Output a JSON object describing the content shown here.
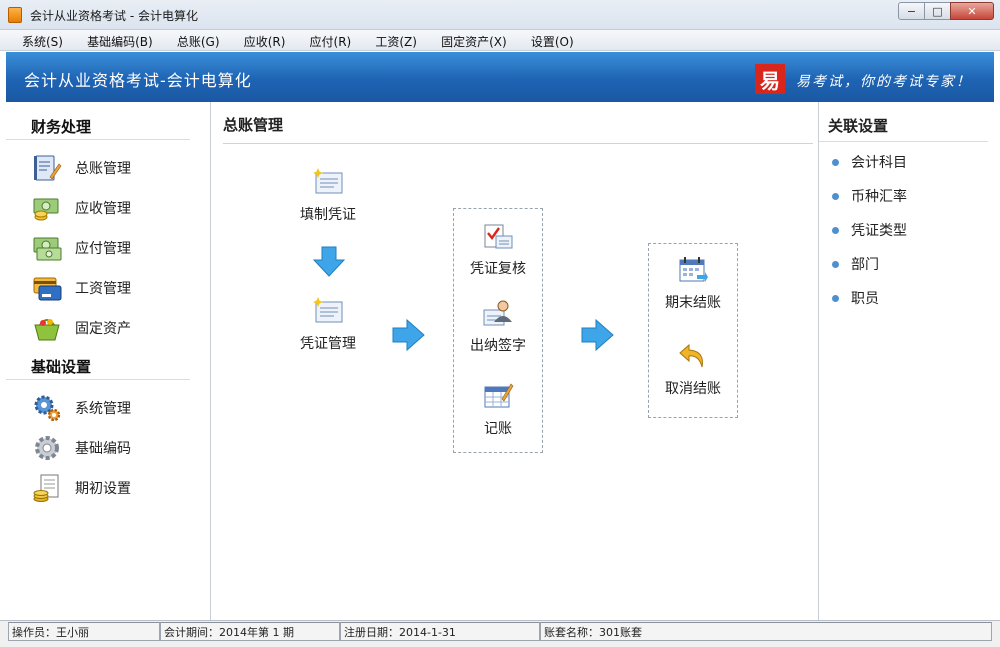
{
  "window": {
    "title": "会计从业资格考试 - 会计电算化",
    "minimize": "−",
    "maximize": "□",
    "close": "✕"
  },
  "menu": [
    "系统(S)",
    "基础编码(B)",
    "总账(G)",
    "应收(R)",
    "应付(R)",
    "工资(Z)",
    "固定资产(X)",
    "设置(O)"
  ],
  "banner": {
    "title": "会计从业资格考试-会计电算化",
    "logo_char": "易",
    "slogan": "易考试，你的考试专家！"
  },
  "left": {
    "finance_title": "财务处理",
    "finance_items": [
      {
        "label": "总账管理",
        "icon": "ledger-icon"
      },
      {
        "label": "应收管理",
        "icon": "receivable-icon"
      },
      {
        "label": "应付管理",
        "icon": "payable-icon"
      },
      {
        "label": "工资管理",
        "icon": "salary-card-icon"
      },
      {
        "label": "固定资产",
        "icon": "asset-basket-icon"
      }
    ],
    "base_title": "基础设置",
    "base_items": [
      {
        "label": "系统管理",
        "icon": "gears-icon"
      },
      {
        "label": "基础编码",
        "icon": "gear-icon"
      },
      {
        "label": "期初设置",
        "icon": "document-coins-icon"
      }
    ]
  },
  "main": {
    "title": "总账管理",
    "flow": {
      "fill_voucher": "填制凭证",
      "manage_voucher": "凭证管理",
      "review_voucher": "凭证复核",
      "cashier_sign": "出纳签字",
      "post_ledger": "记账",
      "period_close": "期末结账",
      "cancel_close": "取消结账"
    }
  },
  "right": {
    "title": "关联设置",
    "items": [
      "会计科目",
      "币种汇率",
      "凭证类型",
      "部门",
      "职员"
    ]
  },
  "status": {
    "operator": "操作员：王小丽",
    "period": "会计期间：2014年第 1 期",
    "reg_date": "注册日期：2014-1-31",
    "account_set": "账套名称：301账套"
  },
  "colors": {
    "banner": "#1e64b4",
    "arrow": "#3ea6e8",
    "bullet": "#4e8fd0"
  }
}
